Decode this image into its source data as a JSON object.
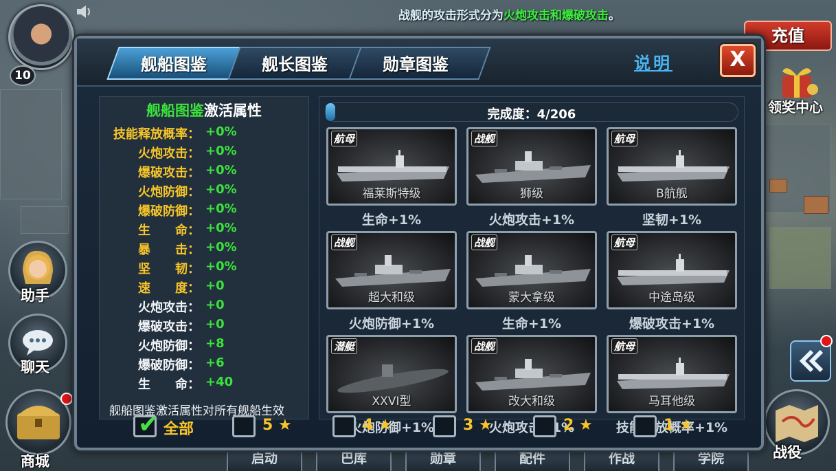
{
  "ticker": {
    "text_prefix": "战舰的攻击形式分为",
    "text_highlight": "火炮攻击和爆破攻击",
    "text_suffix": "。"
  },
  "player": {
    "level": "10"
  },
  "side_menu": {
    "assistant": "助手",
    "chat": "聊天",
    "shop": "商城",
    "campaign": "战役",
    "reward_center": "领奖中心",
    "recharge": "充值"
  },
  "bottom_tabs": [
    "启动",
    "巴库",
    "勋章",
    "配件",
    "作战",
    "学院"
  ],
  "tabs": [
    "舰船图鉴",
    "舰长图鉴",
    "勋章图鉴"
  ],
  "active_tab": 0,
  "help": "说明",
  "close": "X",
  "attributes": {
    "title_green": "舰船图鉴",
    "title_white": "激活属性",
    "rows": [
      {
        "label": "技能释放概率：",
        "value": "+0%",
        "color": "gold"
      },
      {
        "label": "火炮攻击：",
        "value": "+0%",
        "color": "gold"
      },
      {
        "label": "爆破攻击：",
        "value": "+0%",
        "color": "gold"
      },
      {
        "label": "火炮防御：",
        "value": "+0%",
        "color": "gold"
      },
      {
        "label": "爆破防御：",
        "value": "+0%",
        "color": "gold"
      },
      {
        "label": "生　　命：",
        "value": "+0%",
        "color": "gold"
      },
      {
        "label": "暴　　击：",
        "value": "+0%",
        "color": "gold"
      },
      {
        "label": "坚　　韧：",
        "value": "+0%",
        "color": "gold"
      },
      {
        "label": "速　　度：",
        "value": "+0",
        "color": "gold"
      },
      {
        "label": "火炮攻击：",
        "value": "+0",
        "color": "white"
      },
      {
        "label": "爆破攻击：",
        "value": "+0",
        "color": "white"
      },
      {
        "label": "火炮防御：",
        "value": "+8",
        "color": "white"
      },
      {
        "label": "爆破防御：",
        "value": "+6",
        "color": "white"
      },
      {
        "label": "生　　命：",
        "value": "+40",
        "color": "white"
      }
    ],
    "note": "舰船图鉴激活属性对所有舰船生效"
  },
  "progress": {
    "label": "完成度：4/206",
    "current": 4,
    "total": 206
  },
  "ships": [
    {
      "tag": "航母",
      "name": "福莱斯特级",
      "bonus": "生命+1%",
      "kind": "carrier"
    },
    {
      "tag": "战舰",
      "name": "狮级",
      "bonus": "火炮攻击+1%",
      "kind": "battleship"
    },
    {
      "tag": "航母",
      "name": "B航舰",
      "bonus": "坚韧+1%",
      "kind": "carrier"
    },
    {
      "tag": "战舰",
      "name": "超大和级",
      "bonus": "火炮防御+1%",
      "kind": "battleship"
    },
    {
      "tag": "战舰",
      "name": "蒙大拿级",
      "bonus": "生命+1%",
      "kind": "battleship"
    },
    {
      "tag": "航母",
      "name": "中途岛级",
      "bonus": "爆破攻击+1%",
      "kind": "carrier"
    },
    {
      "tag": "潜艇",
      "name": "XXVI型",
      "bonus": "火炮防御+1%",
      "kind": "submarine"
    },
    {
      "tag": "战舰",
      "name": "改大和级",
      "bonus": "火炮攻击+1%",
      "kind": "battleship"
    },
    {
      "tag": "航母",
      "name": "马耳他级",
      "bonus": "技能释放概率+1%",
      "kind": "carrier"
    }
  ],
  "filters": [
    {
      "label": "全部",
      "checked": true,
      "star": false
    },
    {
      "label": "5",
      "checked": false,
      "star": true
    },
    {
      "label": "4",
      "checked": false,
      "star": true
    },
    {
      "label": "3",
      "checked": false,
      "star": true
    },
    {
      "label": "2",
      "checked": false,
      "star": true
    },
    {
      "label": "1",
      "checked": false,
      "star": true
    }
  ]
}
